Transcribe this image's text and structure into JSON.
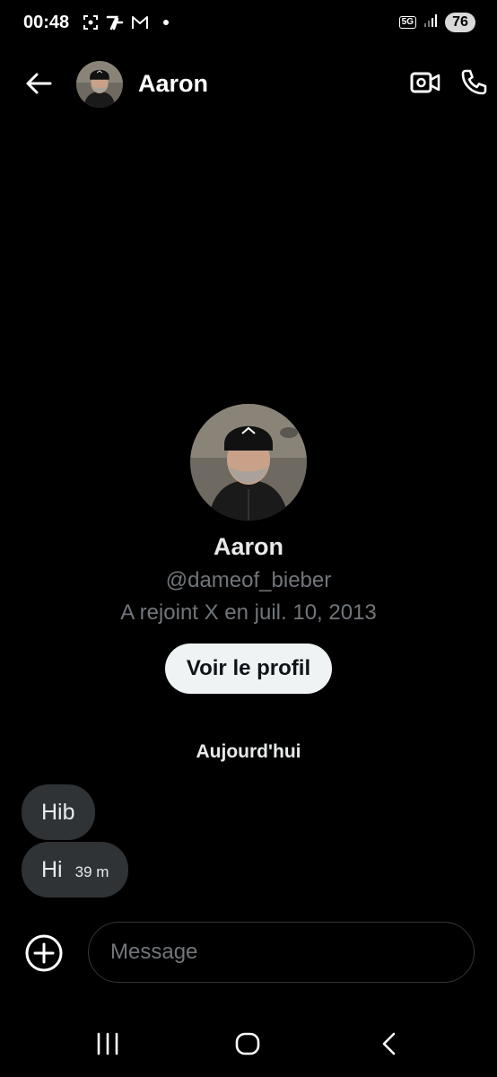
{
  "status_bar": {
    "time": "00:48",
    "network": "5G",
    "battery": "76",
    "icons": [
      "screenshot-icon",
      "app-icon",
      "gmail-icon",
      "notification-dot",
      "signal-icon"
    ]
  },
  "header": {
    "name": "Aaron",
    "icons": [
      "back-arrow-icon",
      "video-call-icon",
      "phone-icon"
    ]
  },
  "profile": {
    "name": "Aaron",
    "handle": "@dameof_bieber",
    "joined": "A rejoint X en juil. 10, 2013",
    "view_profile_label": "Voir le profil"
  },
  "conversation": {
    "date_separator": "Aujourd'hui",
    "messages": [
      {
        "text": "Hib",
        "time": ""
      },
      {
        "text": "Hi",
        "time": "39 m"
      }
    ]
  },
  "composer": {
    "placeholder": "Message",
    "add_icon": "plus-circle-icon"
  },
  "navigation": {
    "icons": [
      "recent-apps-icon",
      "home-icon",
      "back-icon"
    ]
  },
  "colors": {
    "background": "#000000",
    "bubble": "#2f3336",
    "secondary_text": "#71767b",
    "button_bg": "#eff3f4"
  }
}
